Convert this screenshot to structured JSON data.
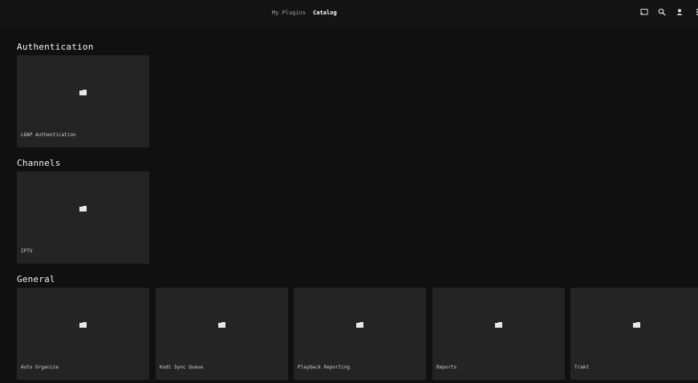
{
  "header": {
    "tabs": [
      {
        "label": "My Plugins"
      },
      {
        "label": "Catalog"
      }
    ],
    "actions": [
      "cast-icon",
      "search-icon",
      "user-icon",
      "more-icon"
    ]
  },
  "sections": [
    {
      "title": "Authentication",
      "items": [
        {
          "label": "LDAP Authentication",
          "icon": "folder-icon"
        }
      ]
    },
    {
      "title": "Channels",
      "items": [
        {
          "label": "IPTV",
          "icon": "folder-icon"
        }
      ]
    },
    {
      "title": "General",
      "items": [
        {
          "label": "Auto Organize",
          "icon": "folder-icon"
        },
        {
          "label": "Kodi Sync Queue",
          "icon": "folder-icon"
        },
        {
          "label": "Playback Reporting",
          "icon": "folder-icon"
        },
        {
          "label": "Reports",
          "icon": "folder-icon"
        },
        {
          "label": "Trakt",
          "icon": "folder-icon"
        }
      ]
    }
  ],
  "colors": {
    "background": "#101010",
    "card": "#242424",
    "text": "#e6e6e6"
  }
}
